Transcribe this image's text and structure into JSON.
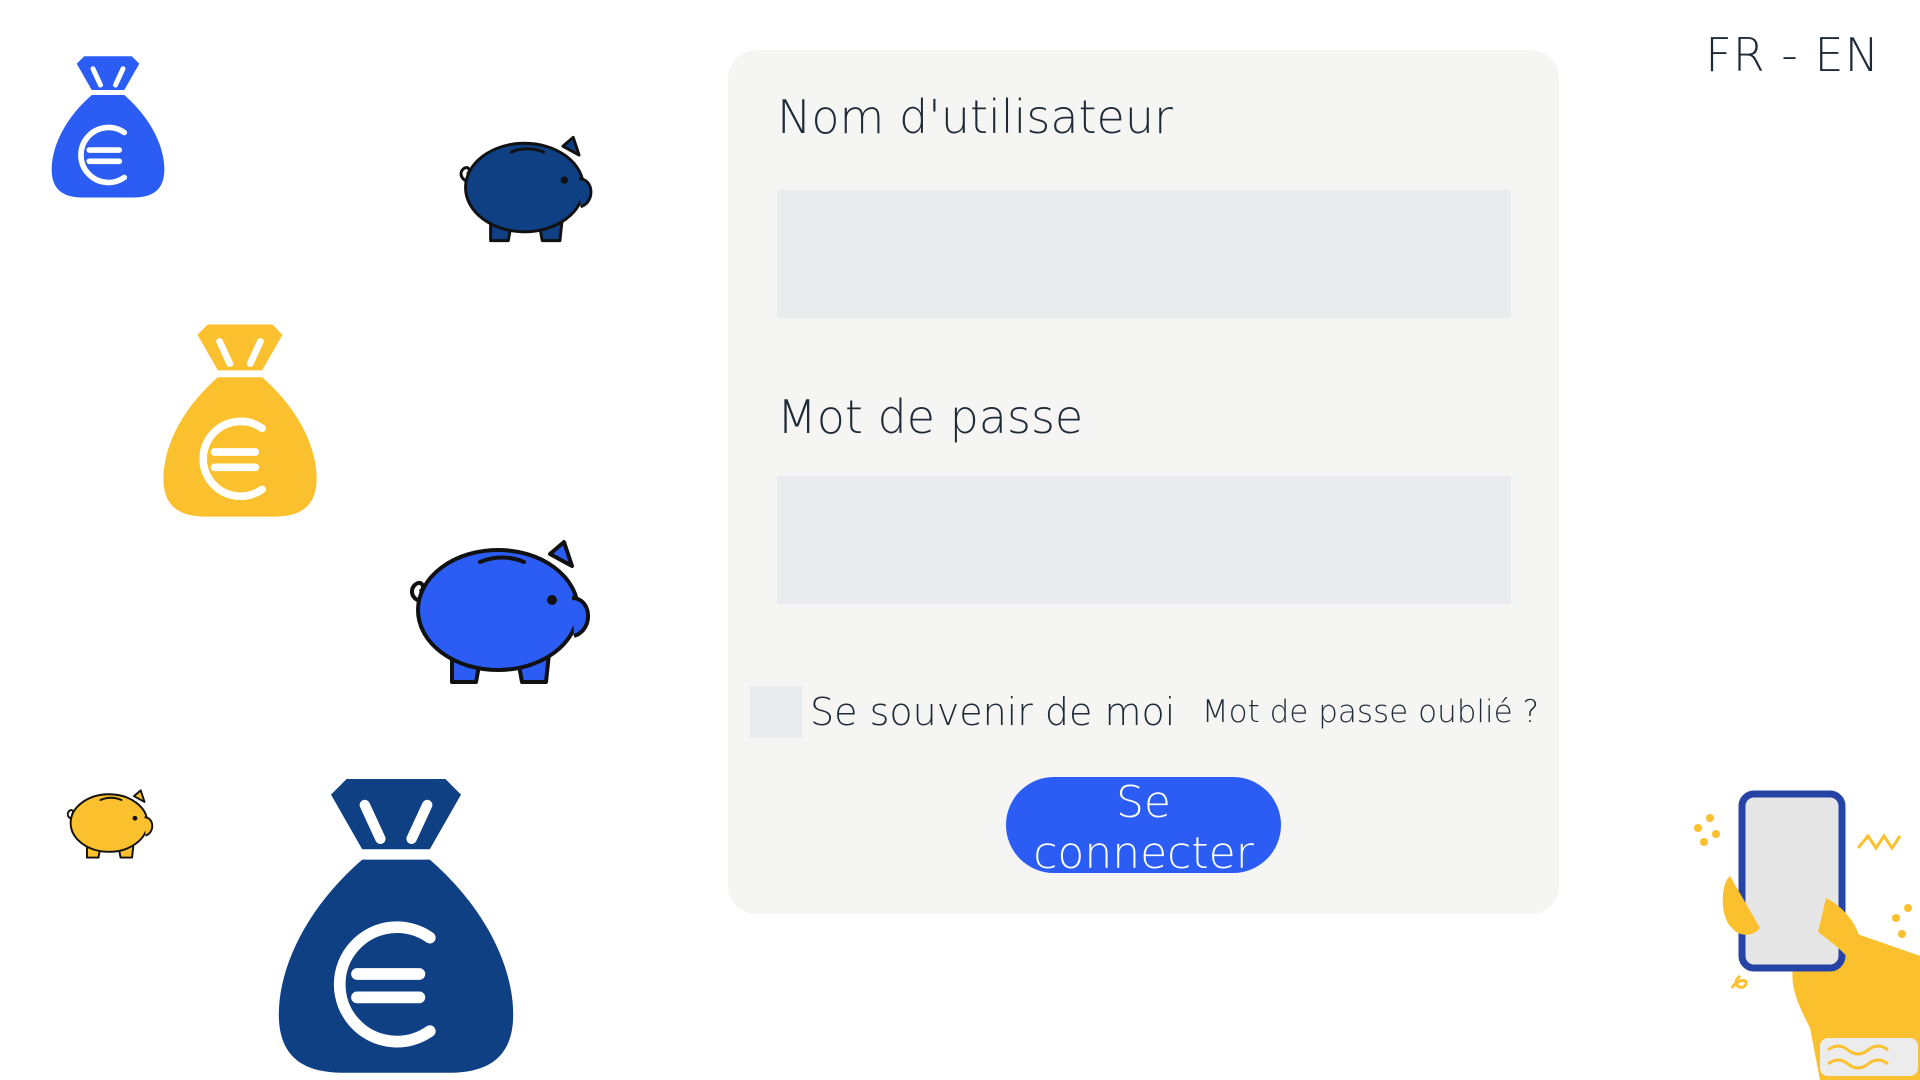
{
  "language_switcher": {
    "fr": "FR",
    "separator": " - ",
    "en": "EN"
  },
  "login_form": {
    "username_label": "Nom d'utilisateur",
    "username_value": "",
    "password_label": "Mot de passe",
    "password_value": "",
    "remember_label": "Se souvenir de moi",
    "remember_checked": false,
    "forgot_link": "Mot de passe oublié ?",
    "submit_label": "Se connecter"
  },
  "colors": {
    "primary_blue": "#2b5df5",
    "dark_blue": "#0f4084",
    "yellow": "#fbc02d",
    "card_background": "#f5f5f4",
    "field_background": "#e9ecee"
  },
  "decorations": {
    "icons": [
      "money-bag-euro-blue-icon",
      "piggy-bank-dark-icon",
      "money-bag-euro-yellow-icon",
      "piggy-bank-blue-icon",
      "piggy-bank-yellow-icon",
      "money-bag-euro-dark-icon",
      "hand-holding-phone-icon"
    ]
  }
}
